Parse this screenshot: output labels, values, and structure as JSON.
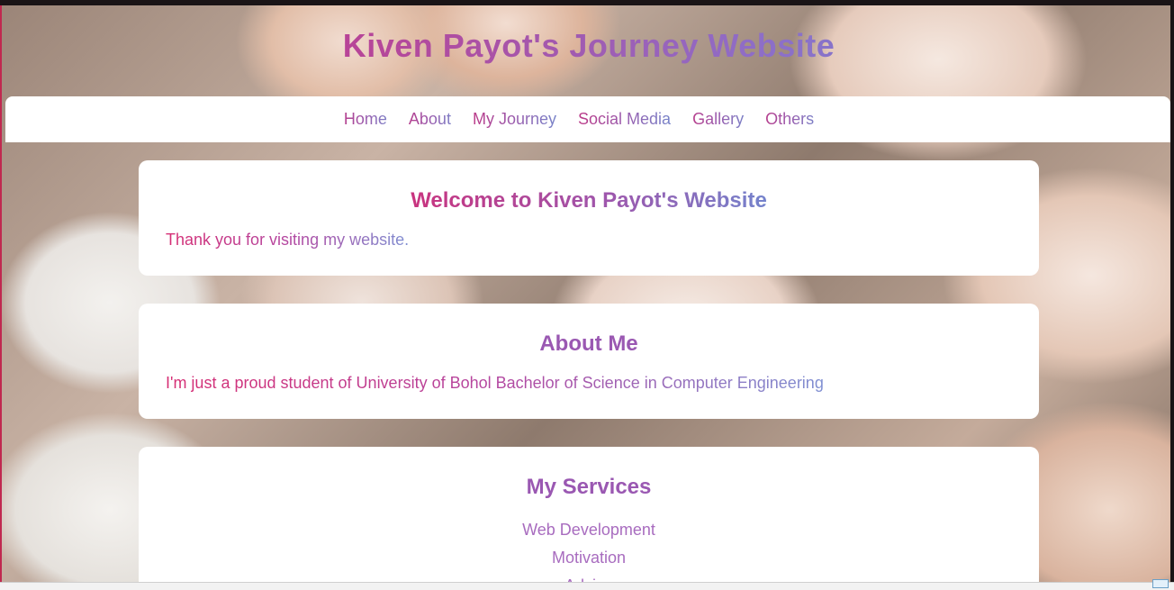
{
  "site": {
    "title": "Kiven Payot's Journey Website"
  },
  "nav": {
    "items": [
      "Home",
      "About",
      "My Journey",
      "Social Media",
      "Gallery",
      "Others"
    ]
  },
  "welcome": {
    "heading": "Welcome to Kiven Payot's Website",
    "text": "Thank you for visiting my website."
  },
  "about": {
    "heading": "About Me",
    "text": "I'm just a proud student of University of Bohol Bachelor of Science in Computer Engineering"
  },
  "services": {
    "heading": "My Services",
    "items": [
      "Web Development",
      "Motivation",
      "Advice"
    ]
  },
  "colors": {
    "accent_pink": "#d4267a",
    "accent_purple": "#9a58b2",
    "accent_blue": "#6f8fd0",
    "card_bg": "#ffffff"
  }
}
